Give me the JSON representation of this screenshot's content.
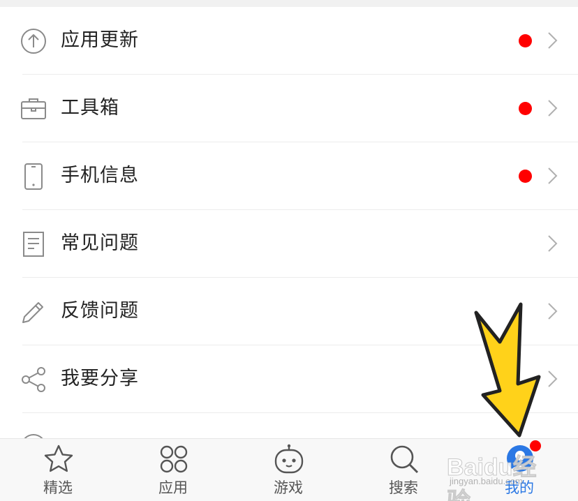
{
  "menu": {
    "items": [
      {
        "label": "应用更新",
        "icon": "upload-circle-icon",
        "badge": true
      },
      {
        "label": "工具箱",
        "icon": "toolbox-icon",
        "badge": true
      },
      {
        "label": "手机信息",
        "icon": "phone-icon",
        "badge": true
      },
      {
        "label": "常见问题",
        "icon": "document-icon",
        "badge": false
      },
      {
        "label": "反馈问题",
        "icon": "pencil-icon",
        "badge": false
      },
      {
        "label": "我要分享",
        "icon": "share-icon",
        "badge": false
      }
    ]
  },
  "tabbar": {
    "tabs": [
      {
        "label": "精选",
        "icon": "star-icon",
        "active": false
      },
      {
        "label": "应用",
        "icon": "apps-grid-icon",
        "active": false
      },
      {
        "label": "游戏",
        "icon": "game-controller-icon",
        "active": false
      },
      {
        "label": "搜索",
        "icon": "search-icon",
        "active": false
      },
      {
        "label": "我的",
        "icon": "profile-icon",
        "active": true,
        "badge": true
      }
    ]
  },
  "watermark": {
    "text": "Baidu经验",
    "sub": "jingyan.baidu.com"
  },
  "colors": {
    "badge": "#ff0000",
    "active": "#2b78e4",
    "arrow": "#ffd21a",
    "icon": "#8a8a8a"
  }
}
